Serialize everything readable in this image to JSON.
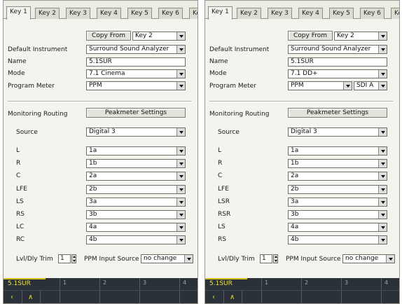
{
  "tabs": [
    "Key 1",
    "Key 2",
    "Key 3",
    "Key 4",
    "Key 5",
    "Key 6",
    "Ke"
  ],
  "panels": {
    "left": {
      "copy_from_label": "Copy From",
      "copy_from_value": "Key 2",
      "default_instrument": {
        "label": "Default Instrument",
        "value": "Surround Sound Analyzer"
      },
      "name": {
        "label": "Name",
        "value": "5.1SUR"
      },
      "mode": {
        "label": "Mode",
        "value": "7.1 Cinema"
      },
      "program_meter": {
        "label": "Program Meter",
        "value": "PPM"
      },
      "monitoring_routing_label": "Monitoring Routing",
      "peakmeter_settings_label": "Peakmeter Settings",
      "source": {
        "label": "Source",
        "value": "Digital 3"
      },
      "channels": [
        {
          "label": "L",
          "value": "1a"
        },
        {
          "label": "R",
          "value": "1b"
        },
        {
          "label": "C",
          "value": "2a"
        },
        {
          "label": "LFE",
          "value": "2b"
        },
        {
          "label": "LS",
          "value": "3a"
        },
        {
          "label": "RS",
          "value": "3b"
        },
        {
          "label": "LC",
          "value": "4a"
        },
        {
          "label": "RC",
          "value": "4b"
        }
      ],
      "lvl_dly_trim": {
        "label": "Lvl/Dly Trim",
        "value": "1"
      },
      "ppm_input_source": {
        "label": "PPM Input Source",
        "value": "no change"
      },
      "softkeys": {
        "title": "5.1SUR",
        "numbers": [
          "1",
          "2",
          "3",
          "4"
        ],
        "nav_left": "‹",
        "nav_up": "∧"
      }
    },
    "right": {
      "copy_from_label": "Copy From",
      "copy_from_value": "Key 2",
      "default_instrument": {
        "label": "Default Instrument",
        "value": "Surround Sound Analyzer"
      },
      "name": {
        "label": "Name",
        "value": "5.1SUR"
      },
      "mode": {
        "label": "Mode",
        "value": "7.1 DD+"
      },
      "program_meter": {
        "label": "Program Meter",
        "value": "PPM",
        "extra": "SDI A"
      },
      "monitoring_routing_label": "Monitoring Routing",
      "peakmeter_settings_label": "Peakmeter Settings",
      "source": {
        "label": "Source",
        "value": "Digital 3"
      },
      "channels": [
        {
          "label": "L",
          "value": "1a"
        },
        {
          "label": "R",
          "value": "1b"
        },
        {
          "label": "C",
          "value": "2a"
        },
        {
          "label": "LFE",
          "value": "2b"
        },
        {
          "label": "LSR",
          "value": "3a"
        },
        {
          "label": "RSR",
          "value": "3b"
        },
        {
          "label": "LS",
          "value": "4a"
        },
        {
          "label": "RS",
          "value": "4b"
        }
      ],
      "lvl_dly_trim": {
        "label": "Lvl/Dly Trim",
        "value": "1"
      },
      "ppm_input_source": {
        "label": "PPM Input Source",
        "value": "no change"
      },
      "softkeys": {
        "title": "5.1SUR",
        "numbers": [
          "1",
          "2",
          "3",
          "4"
        ],
        "nav_left": "‹",
        "nav_up": "∧"
      }
    }
  }
}
